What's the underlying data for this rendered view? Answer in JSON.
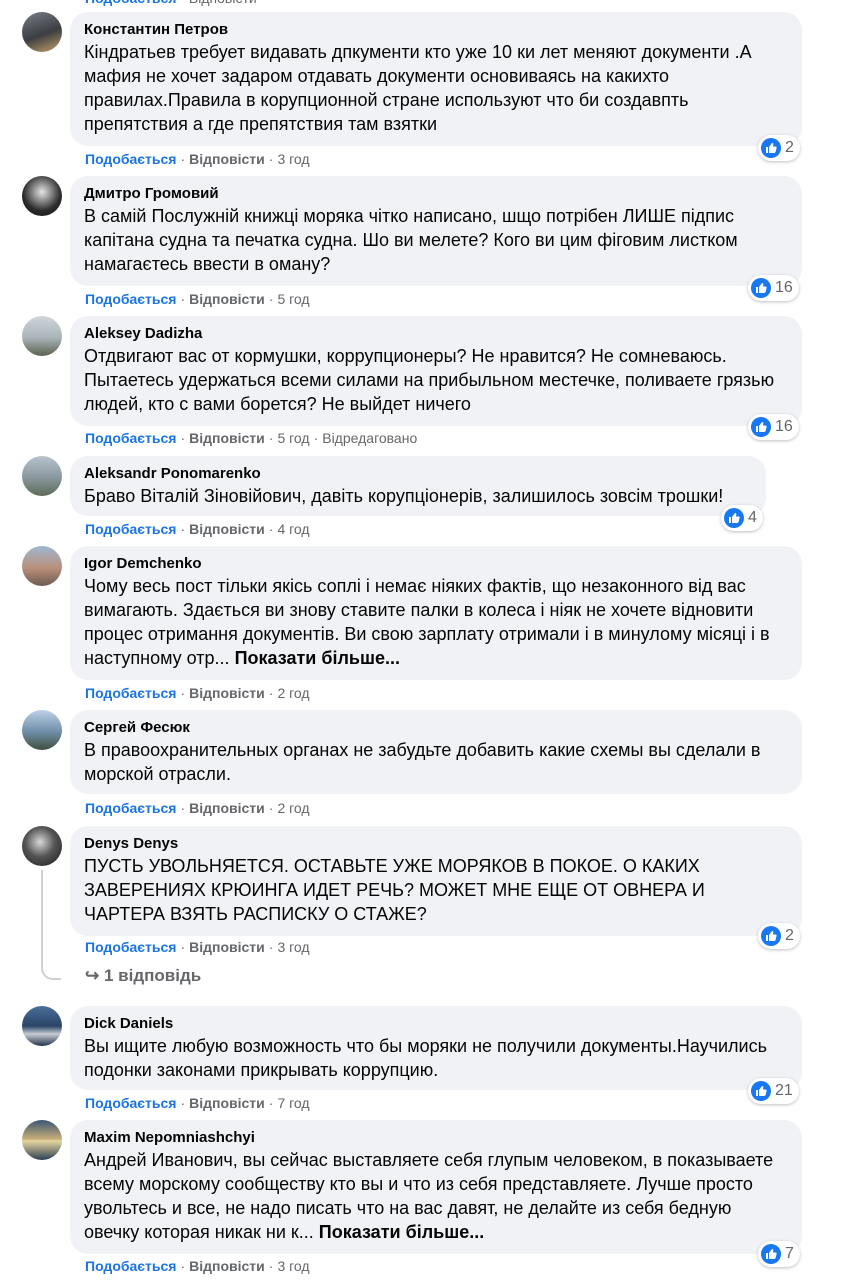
{
  "ui": {
    "like_label": "Подобається",
    "reply_label": "Відповісти",
    "show_more": "Показати більше...",
    "edited_label": "Відредаговано",
    "brand_color": "#1877f2"
  },
  "comments": [
    {
      "author": "Константин Петров",
      "text": "Кіндратьев требует видавать дпкументи кто уже 10 ки лет меняют документи .А мафия не хочет задаром отдавать документи основиваясь на какихто правилах.Правила в корупционной стране используют что би создавпть препятствия а где препятствия там взятки",
      "time": "3 год",
      "reactions": "2"
    },
    {
      "author": "Дмитро Громовий",
      "text": "В самій Послужній книжці моряка чітко написано, шщо потрібен ЛИШЕ підпис капітана судна та печатка судна. Шо ви мелете? Кого ви цим фіговим листком намагаєтесь ввести в оману?",
      "time": "5 год",
      "reactions": "16"
    },
    {
      "author": "Aleksey Dadizha",
      "text": "Отдвигают вас от кормушки, коррупционеры? Не нравится? Не сомневаюсь. Пытаетесь удержаться всеми силами на прибыльном местечке, поливаете грязью людей, кто с вами борется? Не выйдет ничего",
      "time": "5 год",
      "reactions": "16"
    },
    {
      "author": "Aleksandr Ponomarenko",
      "text": "Браво Віталій Зіновійович, давіть корупціонерів, залишилось зовсім трошки!",
      "time": "4 год",
      "reactions": "4"
    },
    {
      "author": "Igor Demchenko",
      "text": "Чому весь пост тільки якісь соплі і немає ніяких фактів, що незаконного від вас вимагають. Здається ви знову ставите палки в колеса і ніяк не хочете відновити процес отримання документів. Ви свою зарплату отримали і в минулому місяці і в наступному отр...",
      "time": "2 год",
      "reactions": ""
    },
    {
      "author": "Сергей Фесюк",
      "text": "В правоохранительных органах не забудьте добавить какие схемы вы сделали в морской отрасли.",
      "time": "2 год",
      "reactions": ""
    },
    {
      "author": "Denys Denys",
      "text": "ПУСТЬ УВОЛЬНЯЕТСЯ. ОСТАВЬТЕ УЖЕ МОРЯКОВ В ПОКОЕ. О КАКИХ ЗАВЕРЕНИЯХ КРЮИНГА ИДЕТ РЕЧЬ? МОЖЕТ МНЕ ЕЩЕ ОТ ОВНЕРА И ЧАРТЕРА ВЗЯТЬ РАСПИСКУ О СТАЖЕ?",
      "time": "3 год",
      "reactions": "2",
      "replies": "1 відповідь"
    },
    {
      "author": "Dick Daniels",
      "text": "Вы ищите любую возможность что бы моряки не получили документы.Научились подонки законами прикрывать коррупцию.",
      "time": "7 год",
      "reactions": "21"
    },
    {
      "author": "Maxim Nepomniashchyi",
      "text": "Андрей Иванович, вы сейчас выставляете себя глупым человеком, в показываете всему морскому сообществу кто вы и что из себя представляете. Лучше просто увольтесь и все, не надо писать что на вас давят, не делайте из себя бедную овечку которая никак ни к...",
      "time": "3 год",
      "reactions": "7"
    }
  ]
}
